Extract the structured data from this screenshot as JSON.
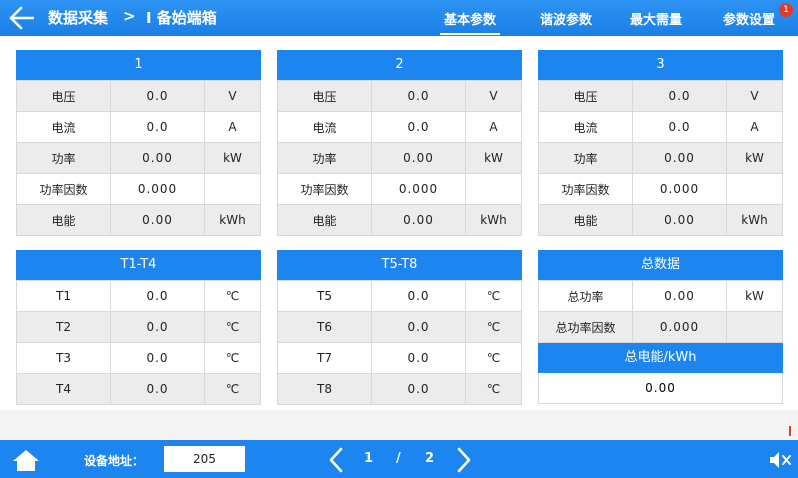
{
  "header": {
    "breadcrumb": [
      {
        "label": "数据采集"
      },
      {
        "separator": ">"
      },
      {
        "label": "I 备始端箱"
      }
    ],
    "tabs": [
      {
        "label": "基本参数",
        "active": true
      },
      {
        "label": "谐波参数",
        "active": false
      },
      {
        "label": "最大需量",
        "active": false
      },
      {
        "label": "参数设置",
        "active": false,
        "badge": "1"
      }
    ]
  },
  "phases": [
    {
      "title": "1",
      "rows": [
        {
          "label": "电压",
          "value": "0.0",
          "unit": "V"
        },
        {
          "label": "电流",
          "value": "0.0",
          "unit": "A"
        },
        {
          "label": "功率",
          "value": "0.00",
          "unit": "kW"
        },
        {
          "label": "功率因数",
          "value": "0.000",
          "unit": ""
        },
        {
          "label": "电能",
          "value": "0.00",
          "unit": "kWh"
        }
      ]
    },
    {
      "title": "2",
      "rows": [
        {
          "label": "电压",
          "value": "0.0",
          "unit": "V"
        },
        {
          "label": "电流",
          "value": "0.0",
          "unit": "A"
        },
        {
          "label": "功率",
          "value": "0.00",
          "unit": "kW"
        },
        {
          "label": "功率因数",
          "value": "0.000",
          "unit": ""
        },
        {
          "label": "电能",
          "value": "0.00",
          "unit": "kWh"
        }
      ]
    },
    {
      "title": "3",
      "rows": [
        {
          "label": "电压",
          "value": "0.0",
          "unit": "V"
        },
        {
          "label": "电流",
          "value": "0.0",
          "unit": "A"
        },
        {
          "label": "功率",
          "value": "0.00",
          "unit": "kW"
        },
        {
          "label": "功率因数",
          "value": "0.000",
          "unit": ""
        },
        {
          "label": "电能",
          "value": "0.00",
          "unit": "kWh"
        }
      ]
    }
  ],
  "temps": [
    {
      "title": "T1-T4",
      "rows": [
        {
          "label": "T1",
          "value": "0.0",
          "unit": "℃"
        },
        {
          "label": "T2",
          "value": "0.0",
          "unit": "℃"
        },
        {
          "label": "T3",
          "value": "0.0",
          "unit": "℃"
        },
        {
          "label": "T4",
          "value": "0.0",
          "unit": "℃"
        }
      ]
    },
    {
      "title": "T5-T8",
      "rows": [
        {
          "label": "T5",
          "value": "0.0",
          "unit": "℃"
        },
        {
          "label": "T6",
          "value": "0.0",
          "unit": "℃"
        },
        {
          "label": "T7",
          "value": "0.0",
          "unit": "℃"
        },
        {
          "label": "T8",
          "value": "0.0",
          "unit": "℃"
        }
      ]
    }
  ],
  "totals": {
    "title": "总数据",
    "rows": [
      {
        "label": "总功率",
        "value": "0.00",
        "unit": "kW"
      },
      {
        "label": "总功率因数",
        "value": "0.000",
        "unit": ""
      }
    ],
    "energy_title": "总电能/kWh",
    "energy_value": "0.00"
  },
  "footer": {
    "address_label": "设备地址：",
    "address_value": "205",
    "page_current": "1",
    "page_separator": "/",
    "page_total": "2"
  },
  "colors": {
    "primary": "#1d85ef",
    "badge": "#e23a2e",
    "row_alt": "#ececec"
  },
  "icons": {
    "back": "arrow-left-icon",
    "home": "home-icon",
    "prev": "chevron-left-icon",
    "next": "chevron-right-icon",
    "mute": "speaker-mute-icon"
  }
}
